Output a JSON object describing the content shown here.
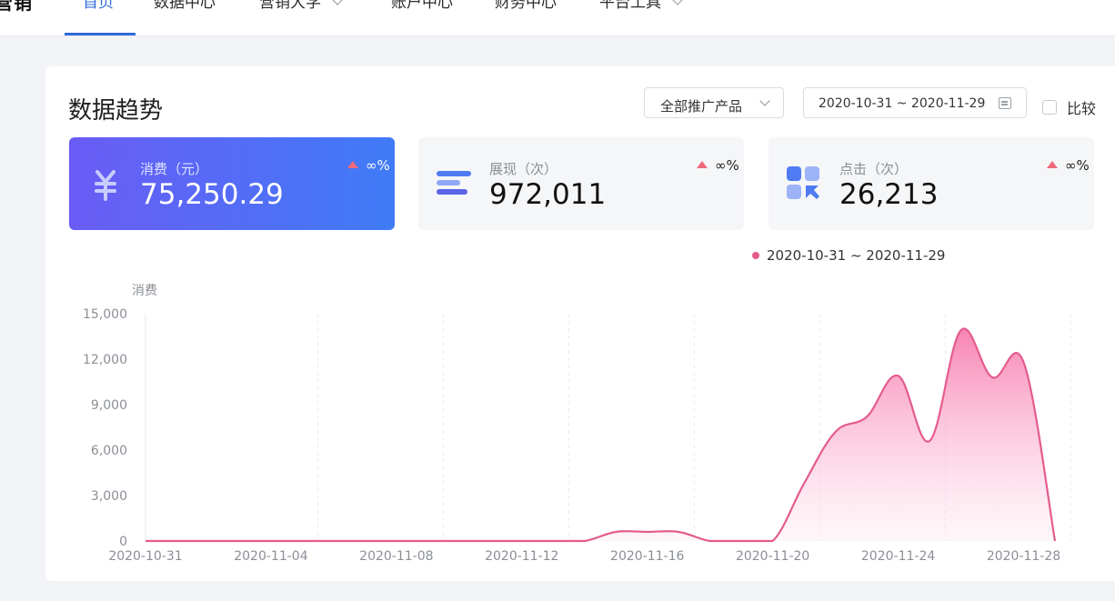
{
  "nav": {
    "brand": "营销",
    "items": [
      {
        "label": "首页",
        "active": true
      },
      {
        "label": "数据中心"
      },
      {
        "label": "营销大学",
        "dropdown": true
      },
      {
        "label": "账户中心"
      },
      {
        "label": "财务中心"
      },
      {
        "label": "平台工具",
        "dropdown": true
      }
    ]
  },
  "panel": {
    "title": "数据趋势",
    "product_select": "全部推广产品",
    "date_range": "2020-10-31 ~ 2020-11-29",
    "compare_label": "比较"
  },
  "metrics": [
    {
      "label": "消费（元）",
      "value": "75,250.29",
      "change": "∞%",
      "icon": "yuan-icon",
      "active": true
    },
    {
      "label": "展现（次）",
      "value": "972,011",
      "change": "∞%",
      "icon": "bars-icon"
    },
    {
      "label": "点击（次）",
      "value": "26,213",
      "change": "∞%",
      "icon": "click-grid-icon"
    }
  ],
  "colors": {
    "accent": "#2f6bd8",
    "card_gradient_start": "#6a5cf6",
    "card_gradient_end": "#3f7bf7",
    "series": "#e45c8e",
    "up_arrow": "#ef6a7a"
  },
  "chart_data": {
    "type": "area",
    "ylabel": "消费",
    "ylim": [
      0,
      15000
    ],
    "yticks": [
      0,
      3000,
      6000,
      9000,
      12000,
      15000
    ],
    "ytick_labels": [
      "0",
      "3,000",
      "6,000",
      "9,000",
      "12,000",
      "15,000"
    ],
    "xtick_labels": [
      "2020-10-31",
      "2020-11-04",
      "2020-11-08",
      "2020-11-12",
      "2020-11-16",
      "2020-11-20",
      "2020-11-24",
      "2020-11-28"
    ],
    "grid": "vertical-dashed",
    "legend_position": "top-right",
    "series": [
      {
        "name": "2020-10-31 ~ 2020-11-29",
        "x": [
          "2020-10-31",
          "2020-11-01",
          "2020-11-02",
          "2020-11-03",
          "2020-11-04",
          "2020-11-05",
          "2020-11-06",
          "2020-11-07",
          "2020-11-08",
          "2020-11-09",
          "2020-11-10",
          "2020-11-11",
          "2020-11-12",
          "2020-11-13",
          "2020-11-14",
          "2020-11-15",
          "2020-11-16",
          "2020-11-17",
          "2020-11-18",
          "2020-11-19",
          "2020-11-20",
          "2020-11-21",
          "2020-11-22",
          "2020-11-23",
          "2020-11-24",
          "2020-11-25",
          "2020-11-26",
          "2020-11-27",
          "2020-11-28",
          "2020-11-29"
        ],
        "values": [
          0,
          0,
          0,
          0,
          0,
          0,
          0,
          0,
          0,
          0,
          0,
          0,
          0,
          0,
          0,
          600,
          600,
          600,
          0,
          0,
          0,
          3800,
          7200,
          8200,
          10900,
          6600,
          13900,
          10800,
          11800,
          0
        ]
      }
    ]
  }
}
